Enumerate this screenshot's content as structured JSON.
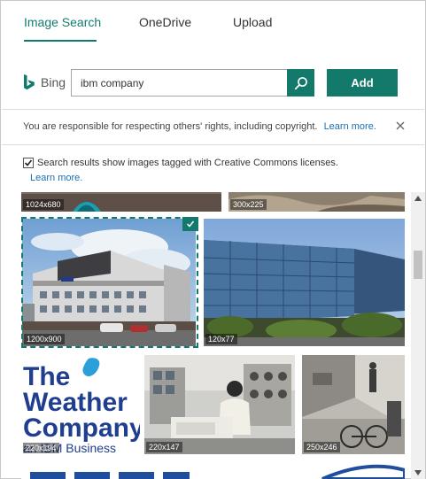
{
  "tabs": [
    {
      "label": "Image Search",
      "active": true
    },
    {
      "label": "OneDrive",
      "active": false
    },
    {
      "label": "Upload",
      "active": false
    }
  ],
  "search": {
    "provider": "Bing",
    "value": "ibm company",
    "search_icon": "search-icon",
    "add_label": "Add"
  },
  "notice": {
    "text": "You are responsible for respecting others' rights, including copyright.",
    "link": "Learn more.",
    "close_icon": "close-icon"
  },
  "creative_commons": {
    "checked": true,
    "label": "Search results show images tagged with Creative Commons licenses.",
    "link": "Learn more."
  },
  "results": [
    {
      "size": "1024x680"
    },
    {
      "size": "300x225"
    },
    {
      "size": "1200x900",
      "selected": true
    },
    {
      "size": "120x77"
    },
    {
      "size": "220x194",
      "logo_text": [
        "The",
        "Weather",
        "Company"
      ],
      "logo_sub": "an IBM Business"
    },
    {
      "size": "220x147"
    },
    {
      "size": "250x246"
    }
  ],
  "colors": {
    "accent": "#107c6e",
    "button": "#137a6b",
    "link": "#1b6fb3",
    "weather_blue": "#1f3e8f"
  }
}
